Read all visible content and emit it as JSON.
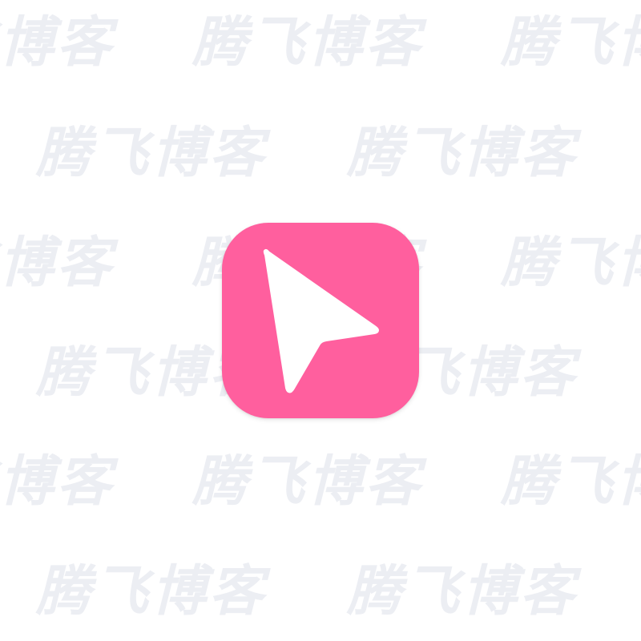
{
  "watermark": {
    "text": "腾飞博客",
    "color": "#eceef3"
  },
  "app_icon": {
    "icon": "cursor-arrow-icon",
    "background_color": "#ff5f9e",
    "glyph_color": "#ffffff"
  }
}
